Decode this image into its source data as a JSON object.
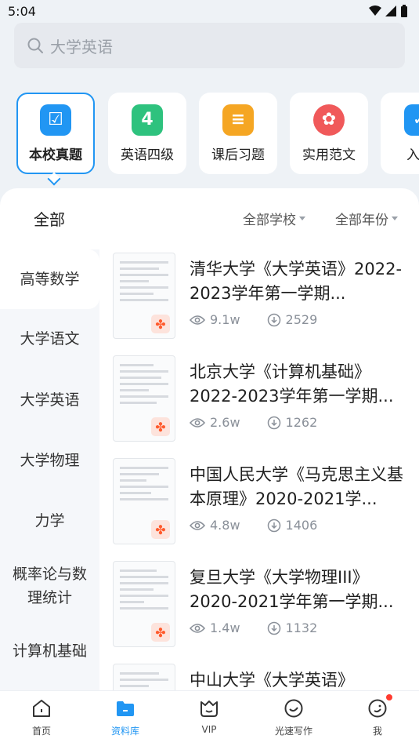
{
  "status": {
    "time": "5:04"
  },
  "search": {
    "placeholder": "大学英语"
  },
  "categories": [
    {
      "label": "本校真题",
      "icon": "checklist-icon",
      "color": "#2196f3",
      "glyph": "☑"
    },
    {
      "label": "英语四级",
      "icon": "number-four-icon",
      "color": "#2ec27e",
      "glyph": "4"
    },
    {
      "label": "课后习题",
      "icon": "exercise-book-icon",
      "color": "#f5a623",
      "glyph": "≡"
    },
    {
      "label": "实用范文",
      "icon": "award-icon",
      "color": "#f0595a",
      "glyph": "✿"
    },
    {
      "label": "入党",
      "icon": "party-icon",
      "color": "#2196f3",
      "glyph": "✓"
    }
  ],
  "filters": {
    "all": "全部",
    "school": "全部学校",
    "year": "全部年份"
  },
  "subjects": [
    "高等数学",
    "大学语文",
    "大学英语",
    "大学物理",
    "力学",
    "概率论与数理统计",
    "计算机基础"
  ],
  "docs": [
    {
      "title": "清华大学《大学英语》2022-2023学年第一学期...",
      "views": "9.1w",
      "downloads": "2529"
    },
    {
      "title": "北京大学《计算机基础》2022-2023学年第一学期...",
      "views": "2.6w",
      "downloads": "1262"
    },
    {
      "title": "中国人民大学《马克思主义基本原理》2020-2021学...",
      "views": "4.8w",
      "downloads": "1406"
    },
    {
      "title": "复旦大学《大学物理III》2020-2021学年第一学期...",
      "views": "1.4w",
      "downloads": "1132"
    },
    {
      "title": "中山大学《大学英语》",
      "views": "",
      "downloads": ""
    }
  ],
  "tabs": [
    {
      "label": "首页",
      "icon": "home-icon"
    },
    {
      "label": "资料库",
      "icon": "folder-icon"
    },
    {
      "label": "VIP",
      "icon": "vip-icon"
    },
    {
      "label": "光速写作",
      "icon": "writing-icon"
    },
    {
      "label": "我",
      "icon": "profile-icon"
    }
  ]
}
